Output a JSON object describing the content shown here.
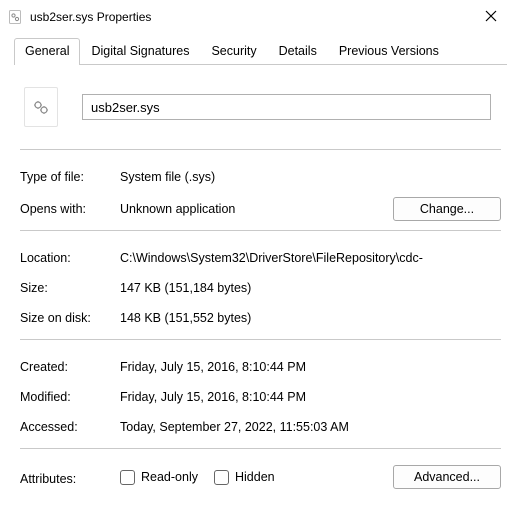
{
  "window": {
    "title": "usb2ser.sys Properties"
  },
  "tabs": {
    "items": [
      "General",
      "Digital Signatures",
      "Security",
      "Details",
      "Previous Versions"
    ],
    "active": 0
  },
  "file": {
    "name": "usb2ser.sys"
  },
  "rows": {
    "type_label": "Type of file:",
    "type_value": "System file (.sys)",
    "opens_label": "Opens with:",
    "opens_value": "Unknown application",
    "change_btn": "Change...",
    "location_label": "Location:",
    "location_value": "C:\\Windows\\System32\\DriverStore\\FileRepository\\cdc-",
    "size_label": "Size:",
    "size_value": "147 KB (151,184 bytes)",
    "sizeondisk_label": "Size on disk:",
    "sizeondisk_value": "148 KB (151,552 bytes)",
    "created_label": "Created:",
    "created_value": "Friday, July 15, 2016, 8:10:44 PM",
    "modified_label": "Modified:",
    "modified_value": "Friday, July 15, 2016, 8:10:44 PM",
    "accessed_label": "Accessed:",
    "accessed_value": "Today, September 27, 2022, 11:55:03 AM",
    "attr_label": "Attributes:",
    "readonly_label": "Read-only",
    "hidden_label": "Hidden",
    "advanced_btn": "Advanced..."
  }
}
